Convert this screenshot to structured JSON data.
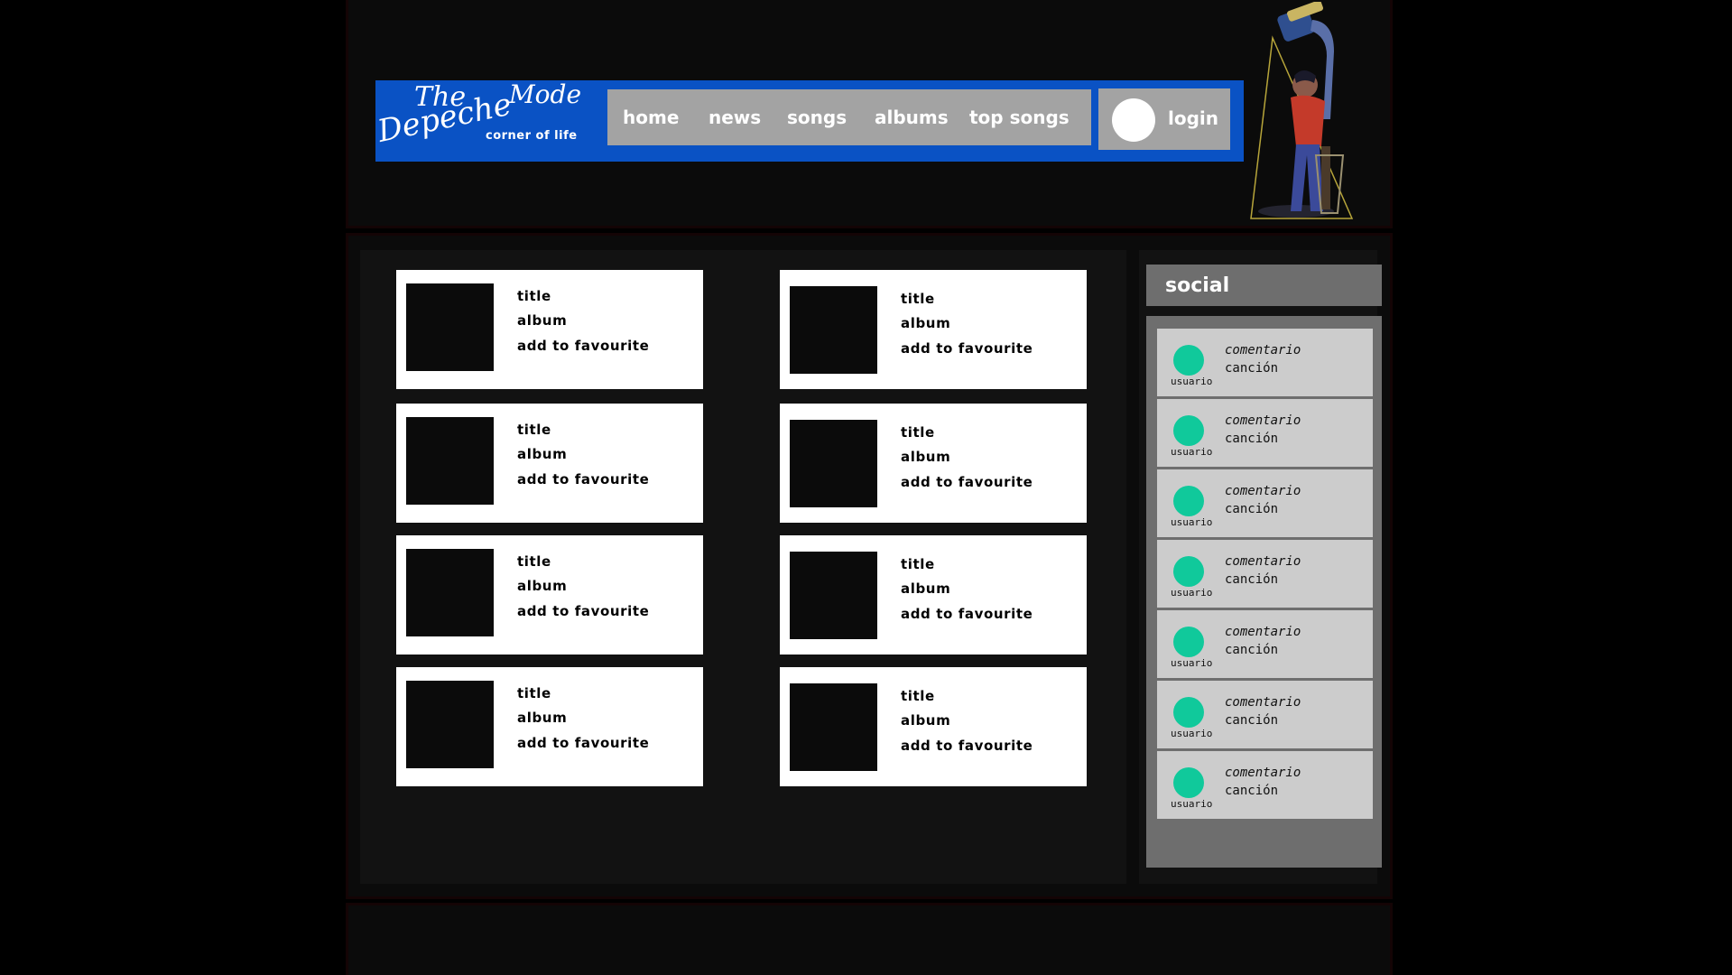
{
  "header": {
    "logo": {
      "line1": "The",
      "line2": "Depeche",
      "line3": "Mode",
      "tagline": "corner of life"
    },
    "nav": [
      "home",
      "news",
      "songs",
      "albums",
      "top songs"
    ],
    "login_label": "login"
  },
  "songs": [
    {
      "title": "title",
      "album": "album",
      "action": "add to favourite"
    },
    {
      "title": "title",
      "album": "album",
      "action": "add to favourite"
    },
    {
      "title": "title",
      "album": "album",
      "action": "add to favourite"
    },
    {
      "title": "title",
      "album": "album",
      "action": "add to favourite"
    },
    {
      "title": "title",
      "album": "album",
      "action": "add to favourite"
    },
    {
      "title": "title",
      "album": "album",
      "action": "add to favourite"
    },
    {
      "title": "title",
      "album": "album",
      "action": "add to favourite"
    },
    {
      "title": "title",
      "album": "album",
      "action": "add to favourite"
    }
  ],
  "social": {
    "title": "social",
    "comments": [
      {
        "user": "usuario",
        "comment": "comentario",
        "song": "canción"
      },
      {
        "user": "usuario",
        "comment": "comentario",
        "song": "canción"
      },
      {
        "user": "usuario",
        "comment": "comentario",
        "song": "canción"
      },
      {
        "user": "usuario",
        "comment": "comentario",
        "song": "canción"
      },
      {
        "user": "usuario",
        "comment": "comentario",
        "song": "canción"
      },
      {
        "user": "usuario",
        "comment": "comentario",
        "song": "canción"
      },
      {
        "user": "usuario",
        "comment": "comentario",
        "song": "canción"
      }
    ]
  },
  "colors": {
    "page_bg": "#000000",
    "panel_bg": "#0b0b0b",
    "banner_blue": "#0a52c4",
    "nav_gray": "#a3a3a3",
    "card_bg": "#ffffff",
    "social_gray": "#6e6e6e",
    "comment_bg": "#cccccc",
    "avatar_green": "#10c99b"
  }
}
